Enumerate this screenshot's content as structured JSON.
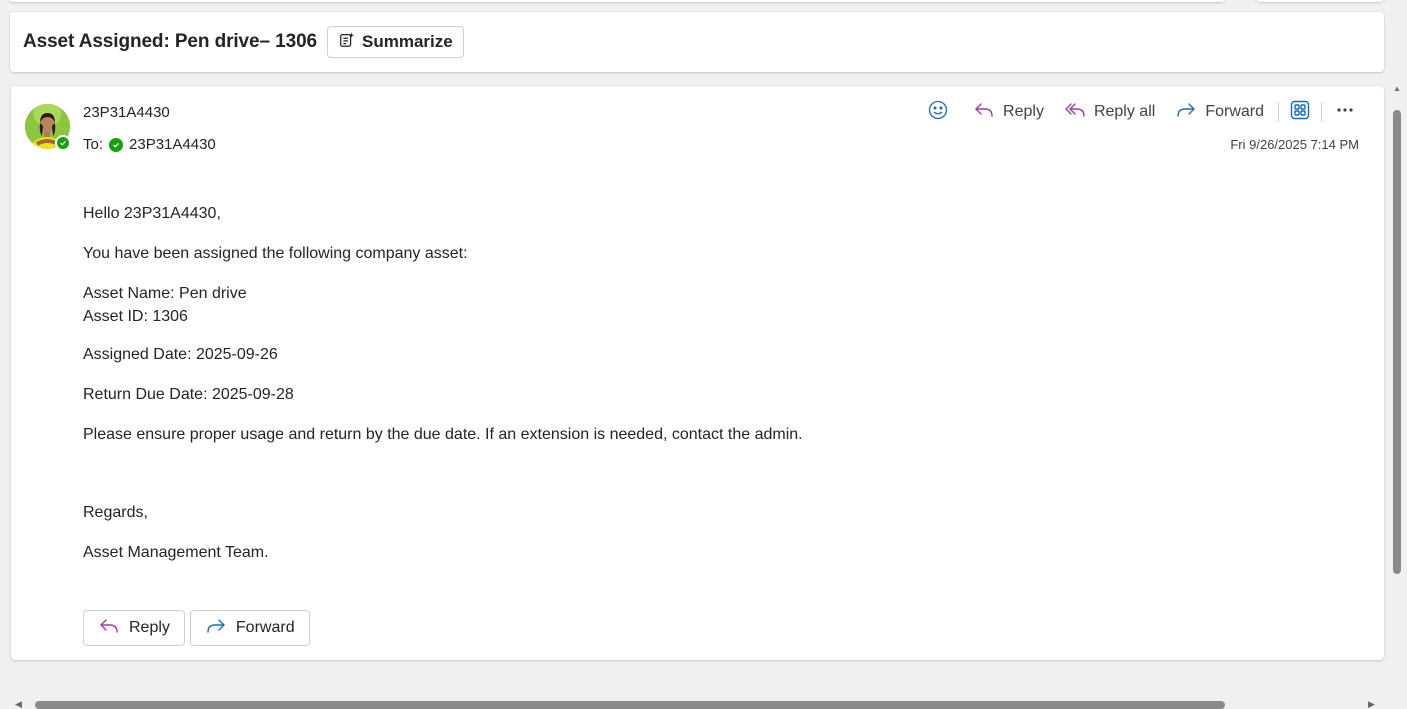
{
  "subject": {
    "title": "Asset Assigned: Pen drive– 1306",
    "summarize_label": "Summarize"
  },
  "message": {
    "sender": "23P31A4430",
    "to_label": "To:",
    "recipient": "23P31A4430",
    "timestamp": "Fri 9/26/2025 7:14 PM",
    "body": {
      "greeting": "Hello 23P31A4430,",
      "intro": "You have been assigned the following company asset:",
      "asset_name": "Asset Name: Pen drive",
      "asset_id": "Asset ID: 1306",
      "assigned_date": "Assigned Date: 2025-09-26",
      "return_due": "Return Due Date: 2025-09-28",
      "note": "Please ensure proper usage and return by the due date. If an extension is needed, contact the admin.",
      "regards": "Regards,",
      "signature": "Asset Management Team."
    }
  },
  "actions": {
    "reply": "Reply",
    "reply_all": "Reply all",
    "forward": "Forward",
    "more": "···"
  },
  "bottom_actions": {
    "reply": "Reply",
    "forward": "Forward"
  },
  "icons": {
    "emoji": "emoji-icon",
    "reply": "reply-icon",
    "reply_all": "reply-all-icon",
    "forward": "forward-icon",
    "apps": "apps-icon",
    "more": "more-icon",
    "summarize": "summarize-icon"
  },
  "colors": {
    "reply_accent": "#9c3fa3",
    "forward_accent": "#1f6fb7",
    "apps_accent": "#0f6cbd",
    "presence_green": "#13a10e"
  }
}
